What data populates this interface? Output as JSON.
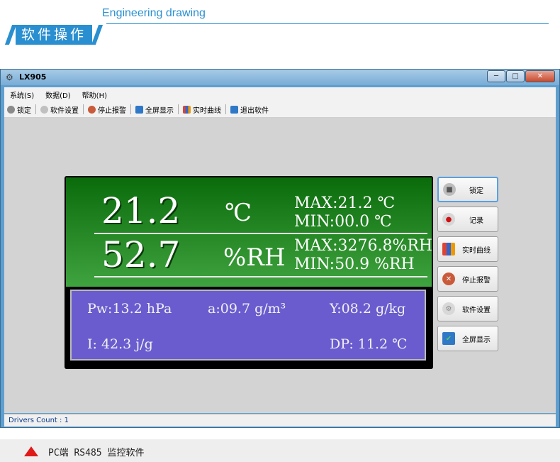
{
  "header": {
    "title": "Engineering drawing",
    "section_label": "软件操作"
  },
  "window": {
    "title": "LX905",
    "menu": [
      "系统(S)",
      "数据(D)",
      "帮助(H)"
    ],
    "toolbar": [
      "锁定",
      "软件设置",
      "停止报警",
      "全屏显示",
      "实时曲线",
      "退出软件"
    ],
    "status": "Drivers Count : 1"
  },
  "display": {
    "temp": "21.2",
    "temp_unit": "℃",
    "temp_max": "MAX:21.2  ℃",
    "temp_min": "MIN:00.0  ℃",
    "hum": "52.7",
    "hum_unit": "%RH",
    "hum_max": "MAX:3276.8%RH",
    "hum_min": "MIN:50.9  %RH",
    "pw": "Pw:13.2  hPa",
    "a": "a:09.7  g/m³",
    "y": "Y:08.2 g/kg",
    "i": "I: 42.3  j/g",
    "dp": "DP: 11.2  ℃"
  },
  "side_buttons": [
    "锁定",
    "记录",
    "实时曲线",
    "停止报警",
    "软件设置",
    "全屏显示"
  ],
  "caption": "PC端 RS485 监控软件",
  "colors": {
    "accent": "#2a8fd0",
    "lcd_green": "#0a6b0a",
    "lcd_blue": "#6a5ccf",
    "triangle": "#e01919"
  }
}
